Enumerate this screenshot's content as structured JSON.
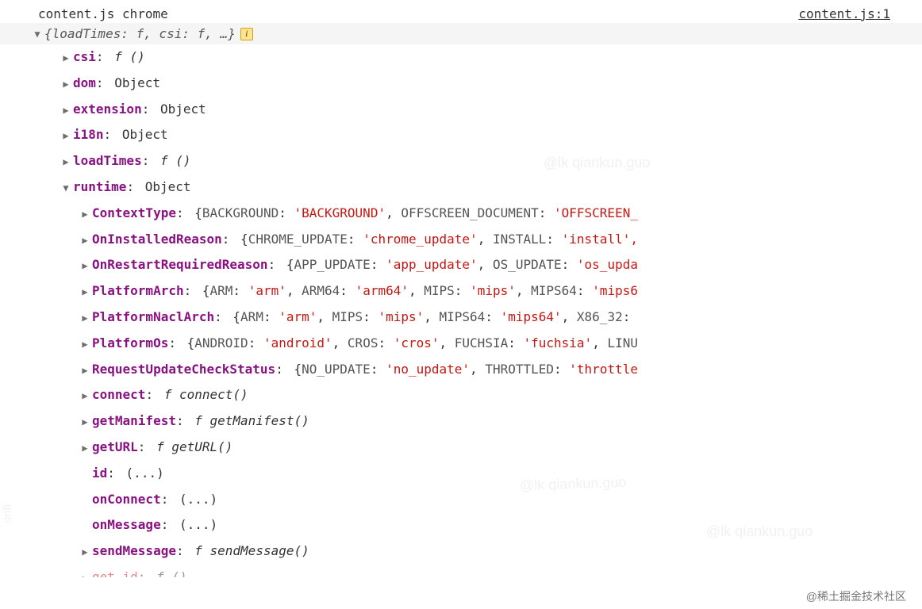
{
  "header": {
    "source_left": "content.js chrome",
    "source_right": "content.js:1"
  },
  "summary": {
    "text": "{loadTimes: f, csi: f, …}"
  },
  "top_props": {
    "csi": {
      "key": "csi",
      "val": "f ()"
    },
    "dom": {
      "key": "dom",
      "val": "Object"
    },
    "extension": {
      "key": "extension",
      "val": "Object"
    },
    "i18n": {
      "key": "i18n",
      "val": "Object"
    },
    "loadTimes": {
      "key": "loadTimes",
      "val": "f ()"
    },
    "runtime": {
      "key": "runtime",
      "val": "Object"
    }
  },
  "runtime_props": {
    "ContextType": {
      "key": "ContextType",
      "enum1k": "BACKGROUND",
      "enum1v": "'BACKGROUND'",
      "enum2k": "OFFSCREEN_DOCUMENT",
      "enum2v": "'OFFSCREEN_"
    },
    "OnInstalledReason": {
      "key": "OnInstalledReason",
      "enum1k": "CHROME_UPDATE",
      "enum1v": "'chrome_update'",
      "enum2k": "INSTALL",
      "enum2v": "'install',"
    },
    "OnRestartRequiredReason": {
      "key": "OnRestartRequiredReason",
      "enum1k": "APP_UPDATE",
      "enum1v": "'app_update'",
      "enum2k": "OS_UPDATE",
      "enum2v": "'os_upda"
    },
    "PlatformArch": {
      "key": "PlatformArch",
      "enum1k": "ARM",
      "enum1v": "'arm'",
      "enum2k": "ARM64",
      "enum2v": "'arm64'",
      "enum3k": "MIPS",
      "enum3v": "'mips'",
      "enum4k": "MIPS64",
      "enum4v": "'mips6"
    },
    "PlatformNaclArch": {
      "key": "PlatformNaclArch",
      "enum1k": "ARM",
      "enum1v": "'arm'",
      "enum2k": "MIPS",
      "enum2v": "'mips'",
      "enum3k": "MIPS64",
      "enum3v": "'mips64'",
      "enum4k": "X86_32",
      "enum4v": ""
    },
    "PlatformOs": {
      "key": "PlatformOs",
      "enum1k": "ANDROID",
      "enum1v": "'android'",
      "enum2k": "CROS",
      "enum2v": "'cros'",
      "enum3k": "FUCHSIA",
      "enum3v": "'fuchsia'",
      "enum4k": "LINU",
      "enum4v": ""
    },
    "RequestUpdateCheckStatus": {
      "key": "RequestUpdateCheckStatus",
      "enum1k": "NO_UPDATE",
      "enum1v": "'no_update'",
      "enum2k": "THROTTLED",
      "enum2v": "'throttle"
    },
    "connect": {
      "key": "connect",
      "val": "f connect()"
    },
    "getManifest": {
      "key": "getManifest",
      "val": "f getManifest()"
    },
    "getURL": {
      "key": "getURL",
      "val": "f getURL()"
    },
    "id": {
      "key": "id",
      "val": "(...)"
    },
    "onConnect": {
      "key": "onConnect",
      "val": "(...)"
    },
    "onMessage": {
      "key": "onMessage",
      "val": "(...)"
    },
    "sendMessage": {
      "key": "sendMessage",
      "val": "f sendMessage()"
    },
    "getid_cut": {
      "key": "get id",
      "val": "f ()"
    }
  },
  "watermarks": {
    "wm1": "@lk qiankun.guo",
    "wm2": "@lk qiankun.guo",
    "wm3": "@lk qiankun.guo",
    "wm4": "guo",
    "footer": "@稀土掘金技术社区"
  }
}
